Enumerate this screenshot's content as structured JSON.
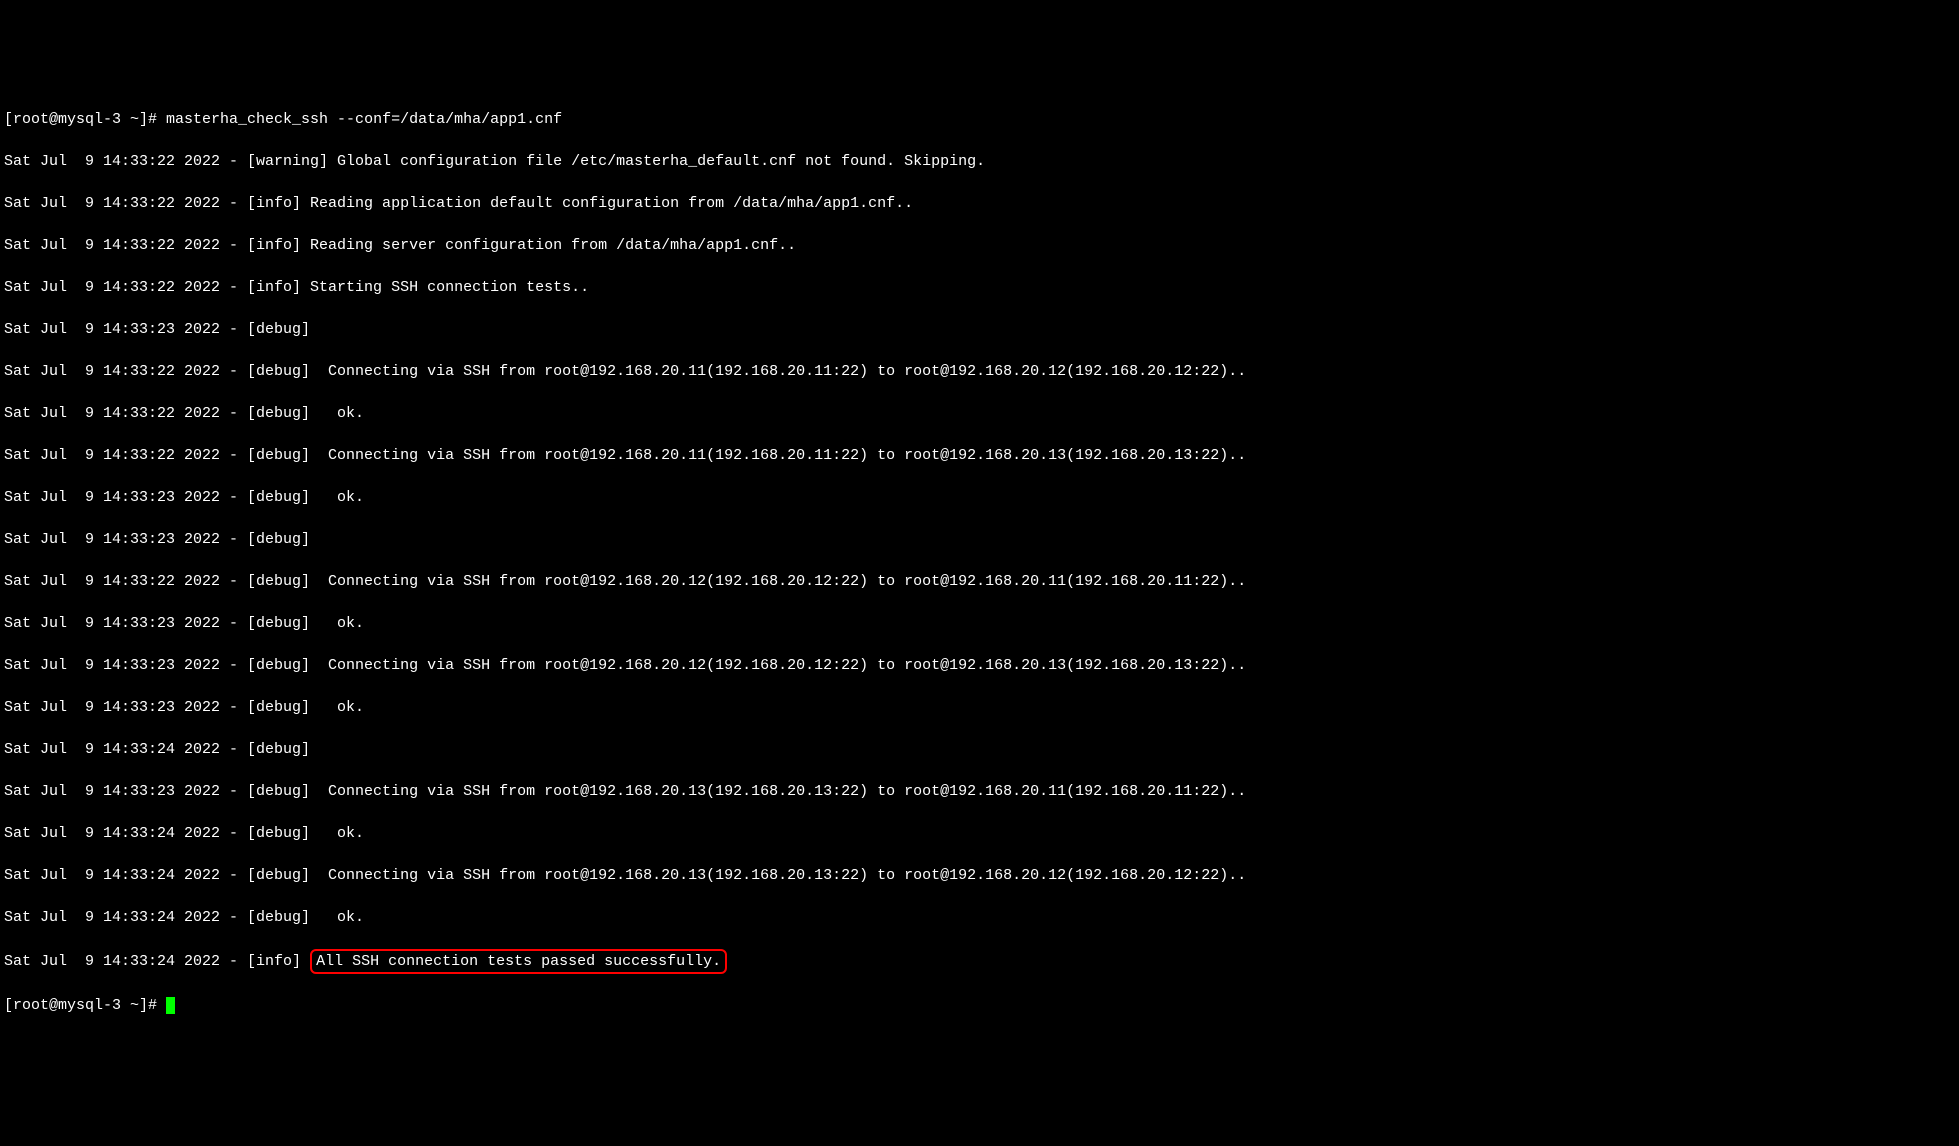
{
  "prompt1": "[root@mysql-3 ~]# ",
  "command": "masterha_check_ssh --conf=/data/mha/app1.cnf",
  "lines": [
    "Sat Jul  9 14:33:22 2022 - [warning] Global configuration file /etc/masterha_default.cnf not found. Skipping.",
    "Sat Jul  9 14:33:22 2022 - [info] Reading application default configuration from /data/mha/app1.cnf..",
    "Sat Jul  9 14:33:22 2022 - [info] Reading server configuration from /data/mha/app1.cnf..",
    "Sat Jul  9 14:33:22 2022 - [info] Starting SSH connection tests..",
    "Sat Jul  9 14:33:23 2022 - [debug] ",
    "Sat Jul  9 14:33:22 2022 - [debug]  Connecting via SSH from root@192.168.20.11(192.168.20.11:22) to root@192.168.20.12(192.168.20.12:22)..",
    "Sat Jul  9 14:33:22 2022 - [debug]   ok.",
    "Sat Jul  9 14:33:22 2022 - [debug]  Connecting via SSH from root@192.168.20.11(192.168.20.11:22) to root@192.168.20.13(192.168.20.13:22)..",
    "Sat Jul  9 14:33:23 2022 - [debug]   ok.",
    "Sat Jul  9 14:33:23 2022 - [debug] ",
    "Sat Jul  9 14:33:22 2022 - [debug]  Connecting via SSH from root@192.168.20.12(192.168.20.12:22) to root@192.168.20.11(192.168.20.11:22)..",
    "Sat Jul  9 14:33:23 2022 - [debug]   ok.",
    "Sat Jul  9 14:33:23 2022 - [debug]  Connecting via SSH from root@192.168.20.12(192.168.20.12:22) to root@192.168.20.13(192.168.20.13:22)..",
    "Sat Jul  9 14:33:23 2022 - [debug]   ok.",
    "Sat Jul  9 14:33:24 2022 - [debug] ",
    "Sat Jul  9 14:33:23 2022 - [debug]  Connecting via SSH from root@192.168.20.13(192.168.20.13:22) to root@192.168.20.11(192.168.20.11:22)..",
    "Sat Jul  9 14:33:24 2022 - [debug]   ok.",
    "Sat Jul  9 14:33:24 2022 - [debug]  Connecting via SSH from root@192.168.20.13(192.168.20.13:22) to root@192.168.20.12(192.168.20.12:22)..",
    "Sat Jul  9 14:33:24 2022 - [debug]   ok."
  ],
  "finalLinePrefix": "Sat Jul  9 14:33:24 2022 - [info] ",
  "finalLineHighlight": "All SSH connection tests passed successfully.",
  "prompt2": "[root@mysql-3 ~]# "
}
